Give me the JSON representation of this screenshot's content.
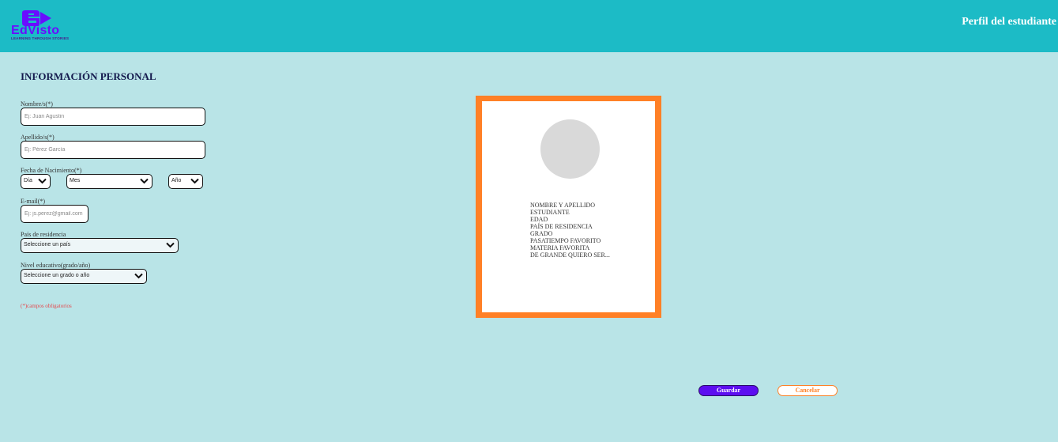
{
  "header": {
    "logo_text": "EdVisto",
    "logo_tagline": "LEARNING THROUGH STORIES",
    "title": "Perfil del estudiante"
  },
  "form": {
    "section_title": "INFORMACIÓN PERSONAL",
    "first_name": {
      "label": "Nombre/s(*)",
      "placeholder": "Ej: Juan Agustin"
    },
    "last_name": {
      "label": "Apellido/s(*)",
      "placeholder": "Ej: Pérez García"
    },
    "birth_date": {
      "label": "Fecha de Nacimiento(*)",
      "day": "Día",
      "month": "Mes",
      "year": "Año"
    },
    "email": {
      "label": "E-mail(*)",
      "placeholder": "Ej: js.perez@gmail.com"
    },
    "country": {
      "label": "País de residencia",
      "value": "Seleccione un país"
    },
    "education": {
      "label": "Nivel educativo(grado/año)",
      "value": "Seleccione un grado o año"
    },
    "required_note": "(*)campos obligatorios"
  },
  "card": {
    "lines": [
      "NOMBRE Y APELLIDO",
      "ESTUDIANTE",
      "EDAD",
      "PAÍS DE RESIDENCIA",
      "GRADO",
      "PASATIEMPO FAVORITO",
      "MATERIA FAVORITA",
      "DE GRANDE QUIERO SER..."
    ]
  },
  "actions": {
    "save_label": "Guardar",
    "cancel_label": "Cancelar"
  },
  "colors": {
    "header_bg": "#1cbbc6",
    "page_bg": "#b9e4e7",
    "card_border": "#ff8026",
    "save_button": "#5c0ef0",
    "required_text": "#e5484d"
  },
  "icons": [
    "edvisto-logo-icon",
    "chevron-down-icon"
  ]
}
